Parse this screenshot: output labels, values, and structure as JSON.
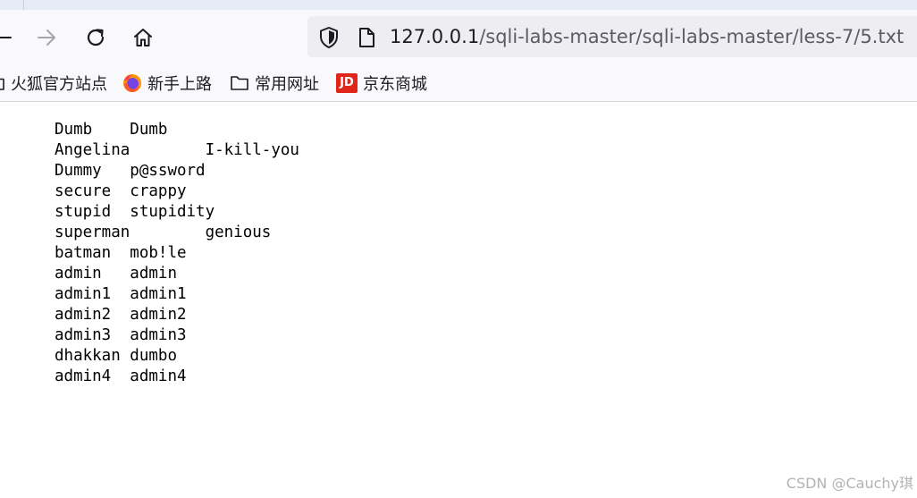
{
  "browser": {
    "nav": {
      "back_icon": "back-arrow-icon",
      "forward_icon": "forward-arrow-icon",
      "reload_icon": "reload-icon",
      "home_icon": "home-icon"
    },
    "urlbar": {
      "host": "127.0.0.1",
      "path": "/sqli-labs-master/sqli-labs-master/less-7/5.txt",
      "shield_icon": "tracking-protection-shield-icon",
      "page_icon": "page-document-icon"
    },
    "bookmarks": [
      {
        "label": "火狐官方站点",
        "icon": "folder-icon"
      },
      {
        "label": "新手上路",
        "icon": "firefox-logo-icon"
      },
      {
        "label": "常用网址",
        "icon": "folder-icon"
      },
      {
        "label": "京东商城",
        "icon": "jd-logo-icon",
        "icon_text": "JD"
      }
    ]
  },
  "document": {
    "lines": [
      "Dumb\tDumb",
      "Angelina\tI-kill-you",
      "Dummy\tp@ssword",
      "secure\tcrappy",
      "stupid\tstupidity",
      "superman\tgenious",
      "batman\tmob!le",
      "admin\tadmin",
      "admin1\tadmin1",
      "admin2\tadmin2",
      "admin3\tadmin3",
      "dhakkan\tdumbo",
      "admin4\tadmin4"
    ]
  },
  "watermark": "CSDN @Cauchy琪",
  "colors": {
    "toolbar_bg": "#f9f9fb",
    "urlbar_bg": "#eeeef2",
    "tabstrip_bg": "#e6ecf5",
    "jd_red": "#e1251b"
  }
}
